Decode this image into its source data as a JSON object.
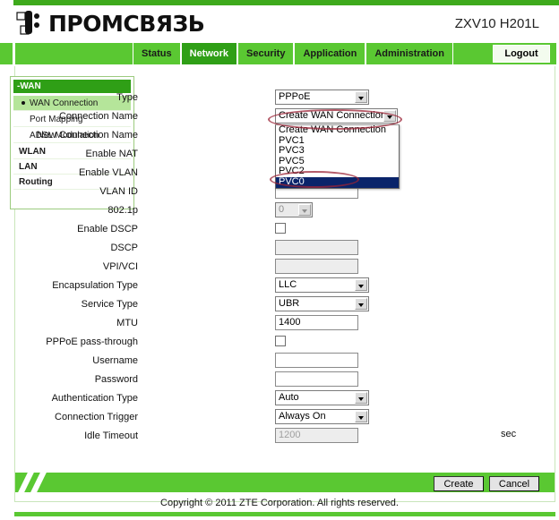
{
  "header": {
    "brand_name": "ПРОМСВЯЗЬ",
    "brand_logo_icon": "promsvyaz-logo-icon",
    "model": "ZXV10 H201L"
  },
  "nav": {
    "tabs": [
      {
        "label": "Status",
        "active": false
      },
      {
        "label": "Network",
        "active": true
      },
      {
        "label": "Security",
        "active": false
      },
      {
        "label": "Application",
        "active": false
      },
      {
        "label": "Administration",
        "active": false
      }
    ],
    "logout_label": "Logout"
  },
  "sidebar": {
    "group_header": "-WAN",
    "items": [
      {
        "label": "WAN Connection",
        "selected": true,
        "level": "sub"
      },
      {
        "label": "Port Mapping",
        "selected": false,
        "level": "sub"
      },
      {
        "label": "ADSL Modulation",
        "selected": false,
        "level": "sub"
      },
      {
        "label": "WLAN",
        "selected": false,
        "level": "top"
      },
      {
        "label": "LAN",
        "selected": false,
        "level": "top"
      },
      {
        "label": "Routing",
        "selected": false,
        "level": "top"
      }
    ]
  },
  "form": {
    "fields": {
      "type": {
        "label": "Type",
        "value": "PPPoE"
      },
      "connection_name": {
        "label": "Connection Name",
        "value": "Create WAN Connection"
      },
      "new_connection_name": {
        "label": "New Connection Name",
        "value": ""
      },
      "enable_nat": {
        "label": "Enable NAT",
        "checked": false
      },
      "enable_vlan": {
        "label": "Enable VLAN",
        "checked": false
      },
      "vlan_id": {
        "label": "VLAN ID",
        "value": ""
      },
      "dot1p": {
        "label": "802.1p",
        "value": "0"
      },
      "enable_dscp": {
        "label": "Enable DSCP",
        "checked": false
      },
      "dscp": {
        "label": "DSCP",
        "value": ""
      },
      "vpi_vci": {
        "label": "VPI/VCI",
        "value": ""
      },
      "encapsulation_type": {
        "label": "Encapsulation Type",
        "value": "LLC"
      },
      "service_type": {
        "label": "Service Type",
        "value": "UBR"
      },
      "mtu": {
        "label": "MTU",
        "value": "1400"
      },
      "pppoe_passthrough": {
        "label": "PPPoE pass-through",
        "checked": false
      },
      "username": {
        "label": "Username",
        "value": ""
      },
      "password": {
        "label": "Password",
        "value": ""
      },
      "authentication_type": {
        "label": "Authentication Type",
        "value": "Auto"
      },
      "connection_trigger": {
        "label": "Connection Trigger",
        "value": "Always On"
      },
      "idle_timeout": {
        "label": "Idle Timeout",
        "value": "1200",
        "unit": "sec"
      }
    },
    "connection_name_dropdown": {
      "open": true,
      "options": [
        "Create WAN Connection",
        "PVC1",
        "PVC3",
        "PVC5",
        "PVC2",
        "PVC0"
      ],
      "highlighted": "PVC0"
    }
  },
  "footer": {
    "create_label": "Create",
    "cancel_label": "Cancel",
    "copyright": "Copyright © 2011 ZTE Corporation. All rights reserved."
  },
  "annotations": {
    "ellipse_color": "#9b2335",
    "marks": [
      "connection-name-select",
      "pvc0-option"
    ]
  },
  "colors": {
    "green_light": "#5ac832",
    "green_dark": "#2f9f16",
    "green_top": "#3eaa1c",
    "select_highlight": "#0a246a",
    "sidebar_selected": "#b5e59a"
  }
}
